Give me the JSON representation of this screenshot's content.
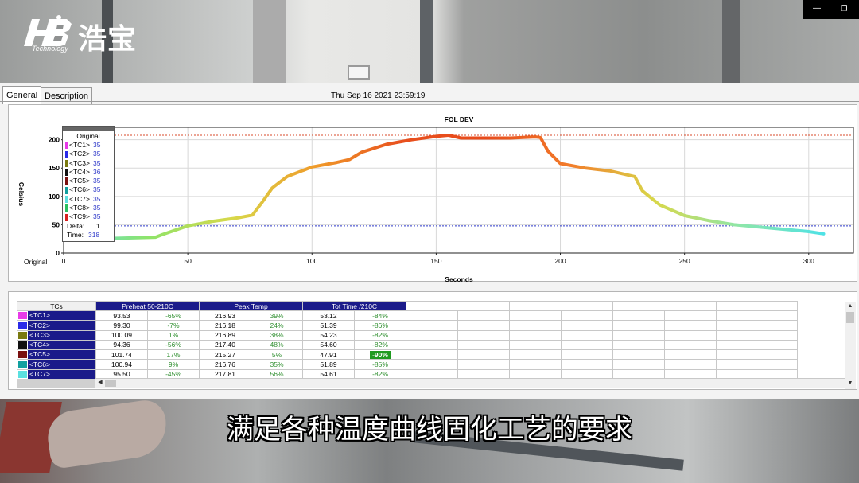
{
  "logo": {
    "chinese": "浩宝",
    "english": "Technology"
  },
  "app": {
    "tabs": [
      {
        "label": "General",
        "active": true
      },
      {
        "label": "Description",
        "active": false
      }
    ],
    "timestamp": "Thu Sep 16 2021 23:59:19"
  },
  "chart_data": {
    "type": "line",
    "title": "FOL DEV",
    "xlabel": "Seconds",
    "ylabel": "Celsius",
    "xlim": [
      0,
      318
    ],
    "ylim": [
      0,
      222
    ],
    "x_ticks": [
      0,
      50,
      100,
      150,
      200,
      250,
      300
    ],
    "y_ticks": [
      0,
      50,
      100,
      150,
      200
    ],
    "x_axis_prefix_label": "Original",
    "grid": true,
    "reference_lines": [
      {
        "y": 208,
        "color": "#d84a2a",
        "style": "dotted"
      },
      {
        "y": 48,
        "color": "#2b36c8",
        "style": "dotted"
      }
    ],
    "series": [
      {
        "x": [
          0,
          20,
          37,
          40,
          50,
          60,
          70,
          76,
          80,
          84,
          90,
          100,
          110,
          115,
          120,
          130,
          140,
          150,
          155,
          160,
          170,
          180,
          185,
          190,
          192,
          195,
          200,
          210,
          220,
          230,
          233,
          240,
          250,
          260,
          270,
          280,
          290,
          300,
          306
        ],
        "y": [
          26,
          26,
          28,
          33,
          48,
          56,
          62,
          67,
          90,
          115,
          135,
          152,
          160,
          165,
          178,
          192,
          200,
          206,
          208,
          203,
          203,
          203,
          204,
          205,
          204,
          180,
          158,
          150,
          145,
          135,
          110,
          85,
          66,
          57,
          50,
          46,
          42,
          38,
          34
        ]
      }
    ],
    "gradient_colors": [
      "#5ee0e4",
      "#8ee46a",
      "#d8d84a",
      "#f09a2a",
      "#e8501e",
      "#e84a1a",
      "#f27c2a",
      "#d8d84a",
      "#8ee6a8",
      "#4ee2e6"
    ]
  },
  "legend": {
    "title": "Original",
    "items": [
      {
        "label": "<TC1>",
        "value": "35",
        "color": "#e83ae8"
      },
      {
        "label": "<TC2>",
        "value": "35",
        "color": "#2a2ae8"
      },
      {
        "label": "<TC3>",
        "value": "35",
        "color": "#7a7a10"
      },
      {
        "label": "<TC4>",
        "value": "36",
        "color": "#101010"
      },
      {
        "label": "<TC5>",
        "value": "35",
        "color": "#7a1010"
      },
      {
        "label": "<TC6>",
        "value": "35",
        "color": "#10a0a0"
      },
      {
        "label": "<TC7>",
        "value": "35",
        "color": "#5ae0e0"
      },
      {
        "label": "<TC8>",
        "value": "35",
        "color": "#2ac060"
      },
      {
        "label": "<TC9>",
        "value": "35",
        "color": "#d82020"
      }
    ],
    "delta_label": "Delta:",
    "delta_value": "1",
    "time_label": "Time:",
    "time_value": "318"
  },
  "table": {
    "tc_header": "TCs",
    "groups": [
      "Preheat  50-210C",
      "Peak Temp",
      "Tot Time /210C"
    ],
    "rows": [
      {
        "tc": "<TC1>",
        "color": "#e83ae8",
        "preheat": "93.53",
        "preheat_pct": "-65%",
        "peak": "216.93",
        "peak_pct": "39%",
        "tot": "53.12",
        "tot_pct": "-84%",
        "hl": false
      },
      {
        "tc": "<TC2>",
        "color": "#2a2ae8",
        "preheat": "99.30",
        "preheat_pct": "-7%",
        "peak": "216.18",
        "peak_pct": "24%",
        "tot": "51.39",
        "tot_pct": "-86%",
        "hl": false
      },
      {
        "tc": "<TC3>",
        "color": "#7a7a10",
        "preheat": "100.09",
        "preheat_pct": "1%",
        "peak": "216.89",
        "peak_pct": "38%",
        "tot": "54.23",
        "tot_pct": "-82%",
        "hl": false
      },
      {
        "tc": "<TC4>",
        "color": "#101010",
        "preheat": "94.36",
        "preheat_pct": "-56%",
        "peak": "217.40",
        "peak_pct": "48%",
        "tot": "54.60",
        "tot_pct": "-82%",
        "hl": false
      },
      {
        "tc": "<TC5>",
        "color": "#7a1010",
        "preheat": "101.74",
        "preheat_pct": "17%",
        "peak": "215.27",
        "peak_pct": "5%",
        "tot": "47.91",
        "tot_pct": "-90%",
        "hl": true
      },
      {
        "tc": "<TC6>",
        "color": "#10a0a0",
        "preheat": "100.94",
        "preheat_pct": "9%",
        "peak": "216.76",
        "peak_pct": "35%",
        "tot": "51.89",
        "tot_pct": "-85%",
        "hl": false
      },
      {
        "tc": "<TC7>",
        "color": "#5ae0e0",
        "preheat": "95.50",
        "preheat_pct": "-45%",
        "peak": "217.81",
        "peak_pct": "56%",
        "tot": "54.61",
        "tot_pct": "-82%",
        "hl": false
      }
    ]
  },
  "subtitle": "满足各种温度曲线固化工艺的要求"
}
